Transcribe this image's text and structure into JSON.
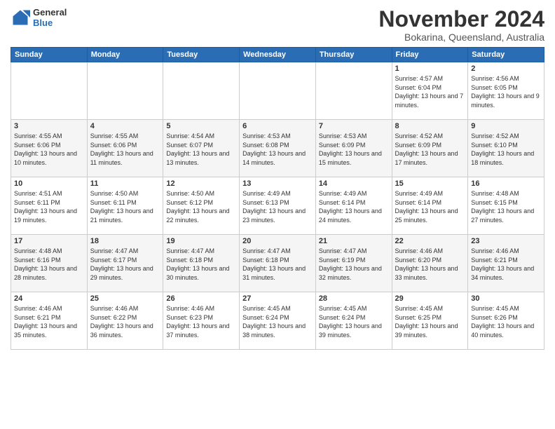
{
  "header": {
    "logo_general": "General",
    "logo_blue": "Blue",
    "month_title": "November 2024",
    "location": "Bokarina, Queensland, Australia"
  },
  "days_of_week": [
    "Sunday",
    "Monday",
    "Tuesday",
    "Wednesday",
    "Thursday",
    "Friday",
    "Saturday"
  ],
  "weeks": [
    [
      {
        "day": "",
        "info": ""
      },
      {
        "day": "",
        "info": ""
      },
      {
        "day": "",
        "info": ""
      },
      {
        "day": "",
        "info": ""
      },
      {
        "day": "",
        "info": ""
      },
      {
        "day": "1",
        "info": "Sunrise: 4:57 AM\nSunset: 6:04 PM\nDaylight: 13 hours and 7 minutes."
      },
      {
        "day": "2",
        "info": "Sunrise: 4:56 AM\nSunset: 6:05 PM\nDaylight: 13 hours and 9 minutes."
      }
    ],
    [
      {
        "day": "3",
        "info": "Sunrise: 4:55 AM\nSunset: 6:06 PM\nDaylight: 13 hours and 10 minutes."
      },
      {
        "day": "4",
        "info": "Sunrise: 4:55 AM\nSunset: 6:06 PM\nDaylight: 13 hours and 11 minutes."
      },
      {
        "day": "5",
        "info": "Sunrise: 4:54 AM\nSunset: 6:07 PM\nDaylight: 13 hours and 13 minutes."
      },
      {
        "day": "6",
        "info": "Sunrise: 4:53 AM\nSunset: 6:08 PM\nDaylight: 13 hours and 14 minutes."
      },
      {
        "day": "7",
        "info": "Sunrise: 4:53 AM\nSunset: 6:09 PM\nDaylight: 13 hours and 15 minutes."
      },
      {
        "day": "8",
        "info": "Sunrise: 4:52 AM\nSunset: 6:09 PM\nDaylight: 13 hours and 17 minutes."
      },
      {
        "day": "9",
        "info": "Sunrise: 4:52 AM\nSunset: 6:10 PM\nDaylight: 13 hours and 18 minutes."
      }
    ],
    [
      {
        "day": "10",
        "info": "Sunrise: 4:51 AM\nSunset: 6:11 PM\nDaylight: 13 hours and 19 minutes."
      },
      {
        "day": "11",
        "info": "Sunrise: 4:50 AM\nSunset: 6:11 PM\nDaylight: 13 hours and 21 minutes."
      },
      {
        "day": "12",
        "info": "Sunrise: 4:50 AM\nSunset: 6:12 PM\nDaylight: 13 hours and 22 minutes."
      },
      {
        "day": "13",
        "info": "Sunrise: 4:49 AM\nSunset: 6:13 PM\nDaylight: 13 hours and 23 minutes."
      },
      {
        "day": "14",
        "info": "Sunrise: 4:49 AM\nSunset: 6:14 PM\nDaylight: 13 hours and 24 minutes."
      },
      {
        "day": "15",
        "info": "Sunrise: 4:49 AM\nSunset: 6:14 PM\nDaylight: 13 hours and 25 minutes."
      },
      {
        "day": "16",
        "info": "Sunrise: 4:48 AM\nSunset: 6:15 PM\nDaylight: 13 hours and 27 minutes."
      }
    ],
    [
      {
        "day": "17",
        "info": "Sunrise: 4:48 AM\nSunset: 6:16 PM\nDaylight: 13 hours and 28 minutes."
      },
      {
        "day": "18",
        "info": "Sunrise: 4:47 AM\nSunset: 6:17 PM\nDaylight: 13 hours and 29 minutes."
      },
      {
        "day": "19",
        "info": "Sunrise: 4:47 AM\nSunset: 6:18 PM\nDaylight: 13 hours and 30 minutes."
      },
      {
        "day": "20",
        "info": "Sunrise: 4:47 AM\nSunset: 6:18 PM\nDaylight: 13 hours and 31 minutes."
      },
      {
        "day": "21",
        "info": "Sunrise: 4:47 AM\nSunset: 6:19 PM\nDaylight: 13 hours and 32 minutes."
      },
      {
        "day": "22",
        "info": "Sunrise: 4:46 AM\nSunset: 6:20 PM\nDaylight: 13 hours and 33 minutes."
      },
      {
        "day": "23",
        "info": "Sunrise: 4:46 AM\nSunset: 6:21 PM\nDaylight: 13 hours and 34 minutes."
      }
    ],
    [
      {
        "day": "24",
        "info": "Sunrise: 4:46 AM\nSunset: 6:21 PM\nDaylight: 13 hours and 35 minutes."
      },
      {
        "day": "25",
        "info": "Sunrise: 4:46 AM\nSunset: 6:22 PM\nDaylight: 13 hours and 36 minutes."
      },
      {
        "day": "26",
        "info": "Sunrise: 4:46 AM\nSunset: 6:23 PM\nDaylight: 13 hours and 37 minutes."
      },
      {
        "day": "27",
        "info": "Sunrise: 4:45 AM\nSunset: 6:24 PM\nDaylight: 13 hours and 38 minutes."
      },
      {
        "day": "28",
        "info": "Sunrise: 4:45 AM\nSunset: 6:24 PM\nDaylight: 13 hours and 39 minutes."
      },
      {
        "day": "29",
        "info": "Sunrise: 4:45 AM\nSunset: 6:25 PM\nDaylight: 13 hours and 39 minutes."
      },
      {
        "day": "30",
        "info": "Sunrise: 4:45 AM\nSunset: 6:26 PM\nDaylight: 13 hours and 40 minutes."
      }
    ]
  ]
}
